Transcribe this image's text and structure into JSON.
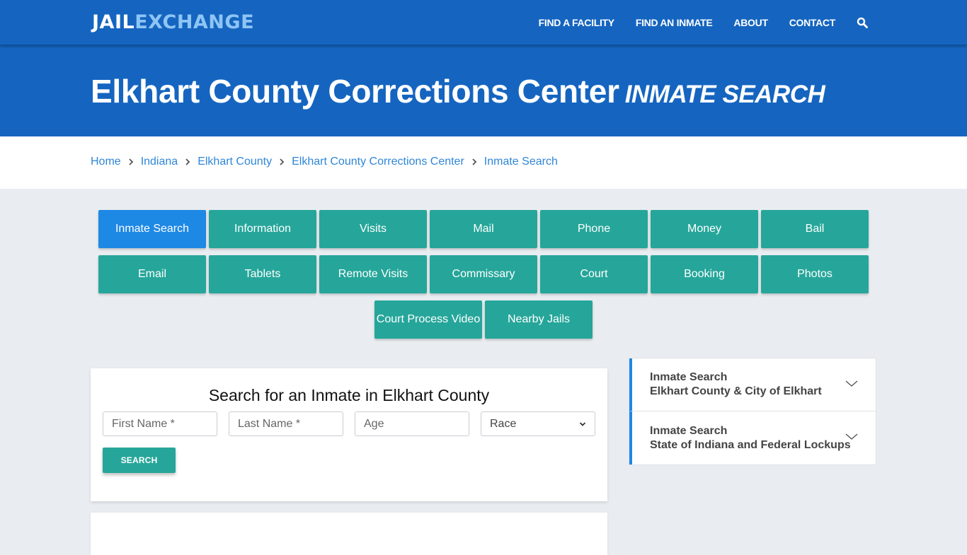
{
  "header": {
    "logo_part1": "JAIL",
    "logo_part2": "EXCHANGE",
    "nav": [
      {
        "label": "FIND A FACILITY"
      },
      {
        "label": "FIND AN INMATE"
      },
      {
        "label": "ABOUT"
      },
      {
        "label": "CONTACT"
      }
    ],
    "search_icon": "search-icon"
  },
  "hero": {
    "title": "Elkhart County Corrections Center",
    "subtitle": "INMATE SEARCH"
  },
  "breadcrumb": [
    {
      "label": "Home"
    },
    {
      "label": "Indiana"
    },
    {
      "label": "Elkhart County"
    },
    {
      "label": "Elkhart County Corrections Center"
    },
    {
      "label": "Inmate Search"
    }
  ],
  "tiles": [
    {
      "label": "Inmate Search",
      "active": true
    },
    {
      "label": "Information"
    },
    {
      "label": "Visits"
    },
    {
      "label": "Mail"
    },
    {
      "label": "Phone"
    },
    {
      "label": "Money"
    },
    {
      "label": "Bail"
    },
    {
      "label": "Email"
    },
    {
      "label": "Tablets"
    },
    {
      "label": "Remote Visits"
    },
    {
      "label": "Commissary"
    },
    {
      "label": "Court"
    },
    {
      "label": "Booking"
    },
    {
      "label": "Photos"
    },
    {
      "label": "Court Process Video"
    },
    {
      "label": "Nearby Jails"
    }
  ],
  "search_form": {
    "title": "Search for an Inmate in Elkhart County",
    "first_name_placeholder": "First Name *",
    "last_name_placeholder": "Last Name *",
    "age_placeholder": "Age",
    "race_selected": "Race",
    "submit_label": "SEARCH"
  },
  "sidebar": {
    "items": [
      {
        "line1": "Inmate Search",
        "line2": "Elkhart County & City of Elkhart"
      },
      {
        "line1": "Inmate Search",
        "line2": "State of Indiana and Federal Lockups"
      }
    ]
  },
  "colors": {
    "brand_blue": "#1565c0",
    "accent_teal": "#26a69a",
    "active_blue": "#1e88e5",
    "link_blue": "#2f86d6",
    "logo_light": "#8ec5f5"
  }
}
